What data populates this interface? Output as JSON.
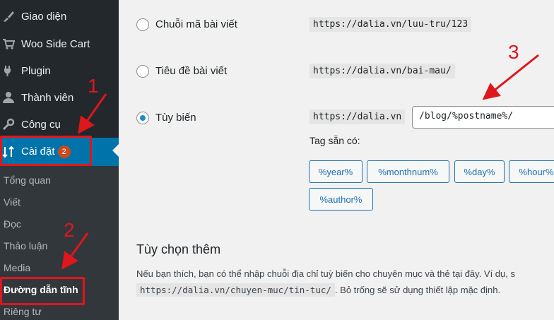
{
  "sidebar": {
    "menu": [
      {
        "label": "Giao diện",
        "icon": "paintbrush-icon"
      },
      {
        "label": "Woo Side Cart",
        "icon": "cart-icon"
      },
      {
        "label": "Plugin",
        "icon": "plug-icon"
      },
      {
        "label": "Thành viên",
        "icon": "user-icon"
      },
      {
        "label": "Công cụ",
        "icon": "wrench-icon"
      }
    ],
    "settings": {
      "label": "Cài đặt",
      "badge": "2",
      "icon": "settings-icon"
    },
    "submenu": [
      "Tổng quan",
      "Viết",
      "Đọc",
      "Thảo luận",
      "Media",
      "Đường dẫn tĩnh",
      "Riêng tư"
    ]
  },
  "permalink": {
    "options": [
      {
        "label": "Chuỗi mã bài viết",
        "example": "https://dalia.vn/luu-tru/123"
      },
      {
        "label": "Tiêu đề bài viết",
        "example": "https://dalia.vn/bai-mau/"
      }
    ],
    "custom": {
      "label": "Tùy biến",
      "base": "https://dalia.vn",
      "value": "/blog/%postname%/"
    },
    "tags_label": "Tag sẵn có:",
    "tags": [
      "%year%",
      "%monthnum%",
      "%day%",
      "%hour%",
      "%author%"
    ]
  },
  "optional": {
    "title": "Tùy chọn thêm",
    "desc_line1": "Nếu bạn thích, bạn có thể nhập chuỗi địa chỉ tuỳ biến cho chuyên mục và thẻ tại đây. Ví dụ, s",
    "desc_code": "https://dalia.vn/chuyen-muc/tin-tuc/",
    "desc_line2": ". Bỏ trống sẽ sử dụng thiết lập mặc định."
  },
  "annotations": {
    "step1": "1",
    "step2": "2",
    "step3": "3",
    "color": "#e0161d"
  }
}
